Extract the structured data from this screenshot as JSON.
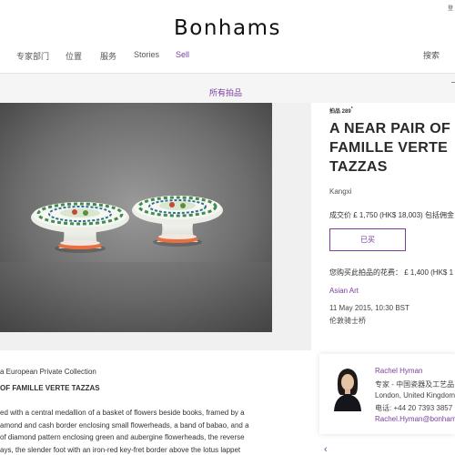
{
  "header": {
    "login_text": "登",
    "logo": "Bonhams",
    "nav": [
      "专家部门",
      "位置",
      "服务",
      "Stories",
      "Sell"
    ],
    "search_label": "搜索"
  },
  "breadcrumb": {
    "all_lots": "所有拍品"
  },
  "lot": {
    "number_label": "拍品 289",
    "number_sup": "*",
    "title_lines": [
      "A NEAR PAIR OF",
      "FAMILLE VERTE",
      "TAZZAS"
    ],
    "subtitle": "Kangxi",
    "sold_price": "成交价 £ 1,750 (HK$ 18,003) 包括佣金",
    "bought_button": "已买",
    "buy_fee": "您购买此拍品的花费： £ 1,400 (HK$ 1",
    "department": "Asian Art",
    "sale_date": "11 May 2015, 10:30 BST",
    "sale_venue": "伦敦骑士桥"
  },
  "description": {
    "provenance": "a European Private Collection",
    "title": "OF FAMILLE VERTE TAZZAS",
    "lines": [
      "ed with a central medallion of a basket of flowers beside books, framed by a",
      "amond and cash border enclosing small flowerheads, a band of babao, and a",
      "of diamond pattern enclosing green and aubergine flowerheads, the reverse",
      "ays, the slender foot with an iron-red key-fret border above the lotus lappet"
    ]
  },
  "specialist": {
    "name": "Rachel Hyman",
    "role": "专家 - 中国瓷器及工艺品",
    "location": "London, United Kingdom",
    "phone": "电话: +44 20 7393 3857",
    "email": "Rachel.Hyman@bonhams.com"
  },
  "colors": {
    "accent": "#7a3e9d",
    "title": "#2a2a2a",
    "band": "#f5f5f5"
  },
  "icons": {
    "prev": "chevron-left-icon"
  }
}
